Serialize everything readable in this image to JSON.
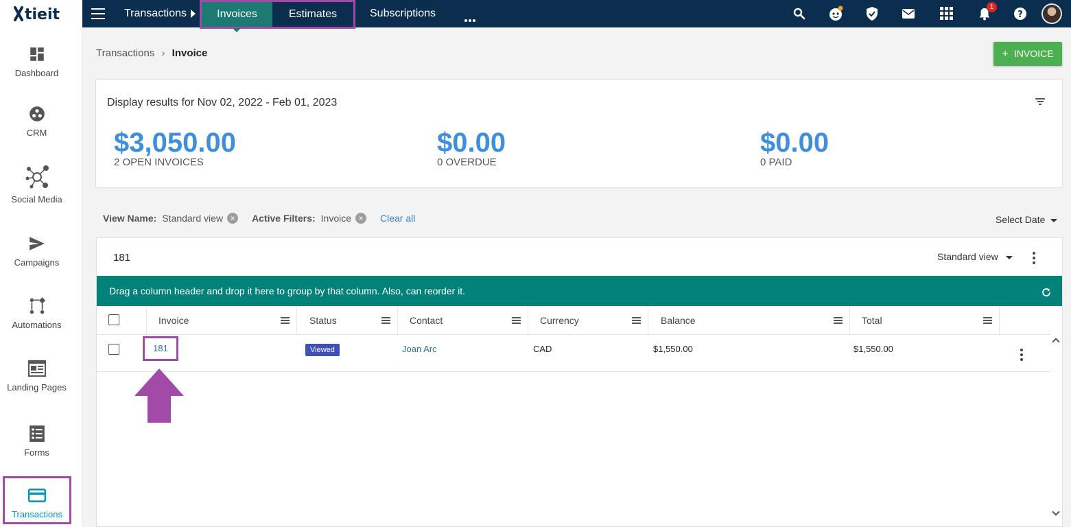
{
  "brand": {
    "logo_text": "tieit"
  },
  "topnav": {
    "section": "Transactions",
    "tabs": [
      {
        "label": "Invoices",
        "active": true
      },
      {
        "label": "Estimates",
        "active": false
      }
    ],
    "subscriptions": "Subscriptions",
    "notifications_count": "1",
    "icons": [
      "menu-icon",
      "search-icon",
      "support-bot-icon",
      "shield-icon",
      "mail-icon",
      "apps-grid-icon",
      "bell-icon",
      "help-icon",
      "user-avatar"
    ]
  },
  "sidebar": {
    "items": [
      {
        "label": "Dashboard",
        "icon": "dashboard-icon"
      },
      {
        "label": "CRM",
        "icon": "crm-icon"
      },
      {
        "label": "Social Media",
        "icon": "social-network-icon"
      },
      {
        "label": "Campaigns",
        "icon": "send-icon"
      },
      {
        "label": "Automations",
        "icon": "automation-icon"
      },
      {
        "label": "Landing Pages",
        "icon": "landing-page-icon"
      },
      {
        "label": "Forms",
        "icon": "form-icon"
      },
      {
        "label": "Transactions",
        "icon": "credit-card-icon",
        "active": true
      }
    ]
  },
  "breadcrumb": {
    "parent": "Transactions",
    "separator": "›",
    "current": "Invoice"
  },
  "add_button": {
    "plus": "+",
    "label": "INVOICE"
  },
  "summary": {
    "range": "Display results for Nov 02, 2022 - Feb 01, 2023",
    "stats": [
      {
        "amount": "$3,050.00",
        "caption": "2 OPEN INVOICES"
      },
      {
        "amount": "$0.00",
        "caption": "0 OVERDUE"
      },
      {
        "amount": "$0.00",
        "caption": "0 PAID"
      }
    ]
  },
  "filters": {
    "view_name_label": "View Name:",
    "view_name_value": "Standard view",
    "active_filters_label": "Active Filters:",
    "active_filters_value": "Invoice",
    "clear_all": "Clear all",
    "select_date": "Select Date"
  },
  "grid": {
    "search_value": "181",
    "view_select": "Standard view",
    "group_hint": "Drag a column header and drop it here to group by that column. Also, can reorder it.",
    "columns": [
      "Invoice",
      "Status",
      "Contact",
      "Currency",
      "Balance",
      "Total"
    ],
    "rows": [
      {
        "invoice": "181",
        "status": "Viewed",
        "contact": "Joan Arc",
        "currency": "CAD",
        "balance": "$1,550.00",
        "total": "$1,550.00"
      }
    ]
  },
  "colors": {
    "topbar": "#0b2d4e",
    "active_tab": "#1d7a72",
    "group_bar": "#038279",
    "amount_blue": "#3f8fdd",
    "add_button": "#4caf50",
    "highlight_outline": "#a24aa8",
    "status_viewed": "#3f51b5"
  }
}
